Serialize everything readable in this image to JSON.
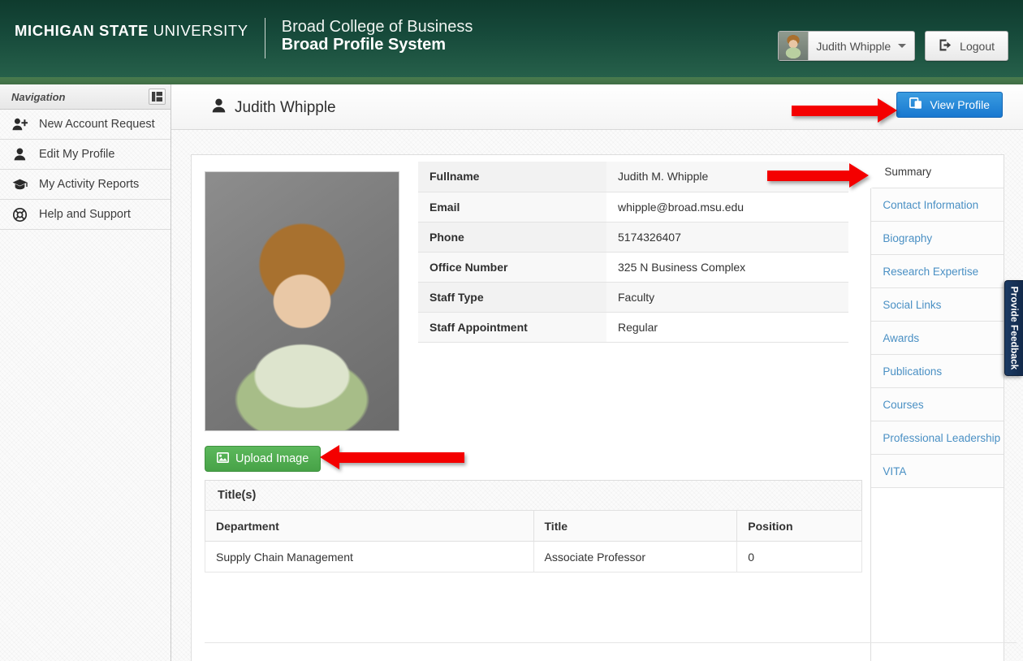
{
  "header": {
    "university_bold": "MICHIGAN STATE",
    "university_light": " UNIVERSITY",
    "college": "Broad College of Business",
    "system": "Broad Profile System",
    "user_name": "Judith Whipple",
    "logout_label": "Logout",
    "accent_color": "#4a7c4e",
    "background_color": "#16493a"
  },
  "navigation": {
    "title": "Navigation",
    "collapse_icon": "panel-collapse-icon",
    "items": [
      {
        "label": "New Account Request",
        "icon": "user-plus-icon"
      },
      {
        "label": "Edit My Profile",
        "icon": "user-icon"
      },
      {
        "label": "My Activity Reports",
        "icon": "graduation-cap-icon"
      },
      {
        "label": "Help and Support",
        "icon": "life-ring-icon"
      }
    ]
  },
  "page": {
    "title": "Judith Whipple",
    "title_icon": "user-icon",
    "view_profile_label": "View Profile",
    "view_profile_icon": "external-window-icon",
    "view_profile_color": "#1878d0"
  },
  "profile": {
    "upload_label": "Upload Image",
    "upload_icon": "picture-icon",
    "upload_color": "#47a247",
    "photo_alt": "Portrait of Judith Whipple",
    "info_rows": [
      {
        "label": "Fullname",
        "value": "Judith M. Whipple"
      },
      {
        "label": "Email",
        "value": "whipple@broad.msu.edu"
      },
      {
        "label": "Phone",
        "value": "5174326407"
      },
      {
        "label": "Office Number",
        "value": "325 N Business Complex"
      },
      {
        "label": "Staff Type",
        "value": "Faculty"
      },
      {
        "label": "Staff Appointment",
        "value": "Regular"
      }
    ]
  },
  "titles": {
    "heading": "Title(s)",
    "columns": [
      "Department",
      "Title",
      "Position"
    ],
    "rows": [
      {
        "department": "Supply Chain Management",
        "title": "Associate Professor",
        "position": "0"
      }
    ]
  },
  "section_nav": {
    "items": [
      {
        "label": "Summary",
        "active": true
      },
      {
        "label": "Contact Information",
        "active": false
      },
      {
        "label": "Biography",
        "active": false
      },
      {
        "label": "Research Expertise",
        "active": false
      },
      {
        "label": "Social Links",
        "active": false
      },
      {
        "label": "Awards",
        "active": false
      },
      {
        "label": "Publications",
        "active": false
      },
      {
        "label": "Courses",
        "active": false
      },
      {
        "label": "Professional Leadership",
        "active": false
      },
      {
        "label": "VITA",
        "active": false
      }
    ]
  },
  "feedback": {
    "label": "Provide Feedback",
    "color": "#12294a"
  },
  "annotations": {
    "arrow_color": "#f40000",
    "count": 3
  }
}
